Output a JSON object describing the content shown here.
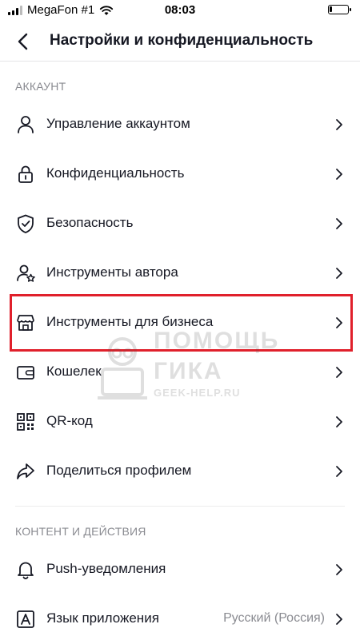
{
  "status_bar": {
    "carrier": "MegaFon #1",
    "time": "08:03",
    "battery_level": 0.15
  },
  "nav": {
    "title": "Настройки и конфиденциальность"
  },
  "sections": [
    {
      "header": "АККАУНТ",
      "items": [
        {
          "label": "Управление аккаунтом",
          "icon": "person-icon"
        },
        {
          "label": "Конфиденциальность",
          "icon": "lock-icon"
        },
        {
          "label": "Безопасность",
          "icon": "shield-icon"
        },
        {
          "label": "Инструменты автора",
          "icon": "person-star-icon"
        },
        {
          "label": "Инструменты для бизнеса",
          "icon": "storefront-icon"
        },
        {
          "label": "Кошелек",
          "icon": "wallet-icon"
        },
        {
          "label": "QR-код",
          "icon": "qr-code-icon"
        },
        {
          "label": "Поделиться профилем",
          "icon": "share-arrow-icon"
        }
      ]
    },
    {
      "header": "КОНТЕНТ И ДЕЙСТВИЯ",
      "items": [
        {
          "label": "Push-уведомления",
          "icon": "bell-icon"
        },
        {
          "label": "Язык приложения",
          "icon": "language-icon",
          "value": "Русский (Россия)"
        }
      ]
    }
  ],
  "watermark": {
    "line1": "ПОМОЩЬ",
    "line2": "ГИКА",
    "line3": "GEEK-HELP.RU"
  },
  "colors": {
    "highlight": "#e0202b",
    "text": "#161823",
    "secondary": "#8a8b91"
  }
}
